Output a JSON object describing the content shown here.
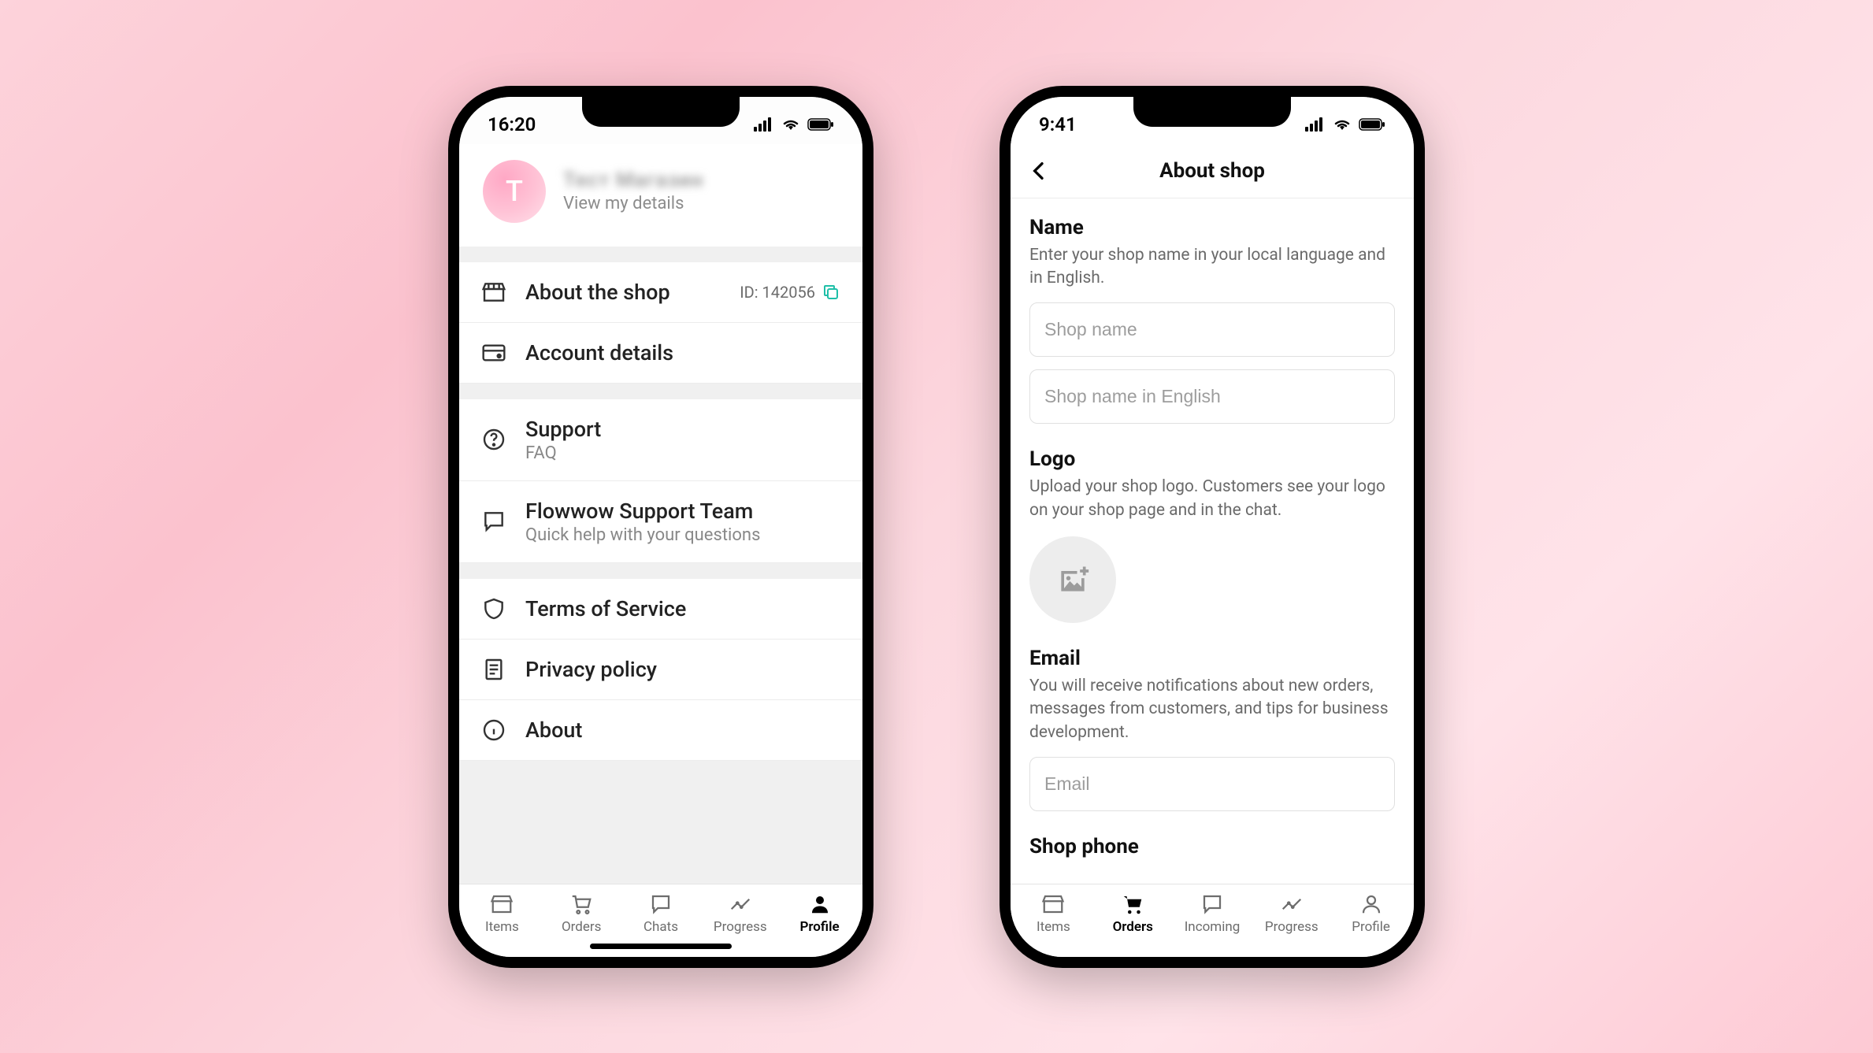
{
  "phone1": {
    "status_time": "16:20",
    "avatar_letter": "T",
    "profile_name": "Тест Магазин",
    "profile_sub": "View my details",
    "menu": {
      "about_shop": "About the shop",
      "shop_id_label": "ID: 142056",
      "account_details": "Account details",
      "support_title": "Support",
      "support_sub": "FAQ",
      "support_team_title": "Flowwow Support Team",
      "support_team_sub": "Quick help with your questions",
      "terms": "Terms of Service",
      "privacy": "Privacy policy",
      "about": "About"
    },
    "nav": {
      "items": "Items",
      "orders": "Orders",
      "chats": "Chats",
      "progress": "Progress",
      "profile": "Profile"
    }
  },
  "phone2": {
    "status_time": "9:41",
    "header_title": "About shop",
    "name_label": "Name",
    "name_help": "Enter your shop name in your local language and in English.",
    "shop_name_placeholder": "Shop name",
    "shop_name_en_placeholder": "Shop name in English",
    "logo_label": "Logo",
    "logo_help": "Upload your shop logo. Customers see your logo on your shop page and in the chat.",
    "email_label": "Email",
    "email_help": "You will receive notifications about new orders, messages from customers, and tips for business development.",
    "email_placeholder": "Email",
    "shop_phone_label": "Shop phone",
    "nav": {
      "items": "Items",
      "orders": "Orders",
      "incoming": "Incoming",
      "progress": "Progress",
      "profile": "Profile"
    }
  }
}
